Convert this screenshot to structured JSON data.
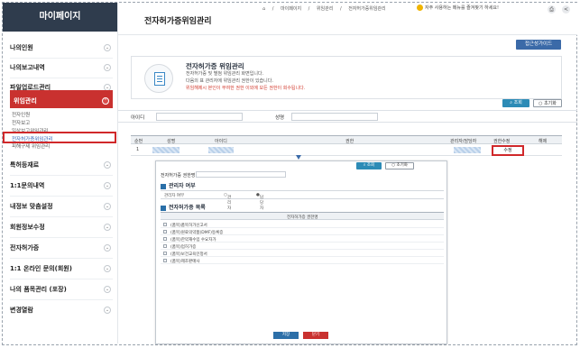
{
  "sidebar": {
    "header": "마이페이지",
    "items": [
      {
        "label": "나의인원"
      },
      {
        "label": "나의보고내역"
      },
      {
        "label": "파일업로드관리"
      },
      {
        "label": "위임관리"
      }
    ],
    "sub_items": [
      {
        "label": "전자인원"
      },
      {
        "label": "전자보고"
      },
      {
        "label": "일상보고위임관리"
      },
      {
        "label": "전자허가증위임관리"
      },
      {
        "label": "피해구제 위임관리"
      }
    ],
    "items_after": [
      {
        "label": "특허등재료"
      },
      {
        "label": "1:1문의내역"
      },
      {
        "label": "내정보 맞춤설정"
      },
      {
        "label": "회원정보수정"
      },
      {
        "label": "전자허가증"
      },
      {
        "label": "1:1 온라인 문의(회원)"
      },
      {
        "label": "나의 품목관리 (포장)"
      },
      {
        "label": "변경열람"
      }
    ]
  },
  "header": {
    "title": "전자허가증위임관리",
    "breadcrumbs": [
      "마이페이지",
      "위임관리",
      "전자허가증위임관리"
    ],
    "favorite_text": "자주 사용하는 메뉴를 즐겨찾기 하세요!"
  },
  "guide_button": "접근성가이드",
  "info": {
    "title": "전자허가증 위임관리",
    "lines": [
      "전자허가증 및 별첨 위임관리 화면입니다.",
      "다음의 표 관리자에 위임관리 권한이 있습니다."
    ],
    "warning": "위임해제시 본인이 부여한 권한 이외에 모든 권한이 회수됩니다."
  },
  "search": {
    "search_button": "조회",
    "reset_button": "초기화",
    "id_label": "아이디",
    "name_label": "성명"
  },
  "table": {
    "headers": [
      "순번",
      "성명",
      "아이디",
      "권한",
      "관리자/담당자",
      "권한수정",
      "해제"
    ],
    "rows": [
      {
        "no": "1",
        "edit": "수정"
      }
    ]
  },
  "popup": {
    "field_label": "전자허가증 권한명",
    "search_button": "조회",
    "reset_button": "초기화",
    "section1": "관리자 여부",
    "radio_label": "관리자 여부",
    "radio_opt1": "관리자",
    "radio_opt2": "담당자",
    "section2": "전자허가증 목록",
    "grid_header": "전자허가증 권한명",
    "grid_rows": [
      "(품목)품목허가신고서",
      "(품목)원료의약품(DMF)등록증",
      "(품목)한약재수입 수요자가",
      "(품목)업허가증",
      "(품목)보건교육인정서",
      "(품목)제조판매사"
    ],
    "save": "저장",
    "close": "닫기"
  }
}
